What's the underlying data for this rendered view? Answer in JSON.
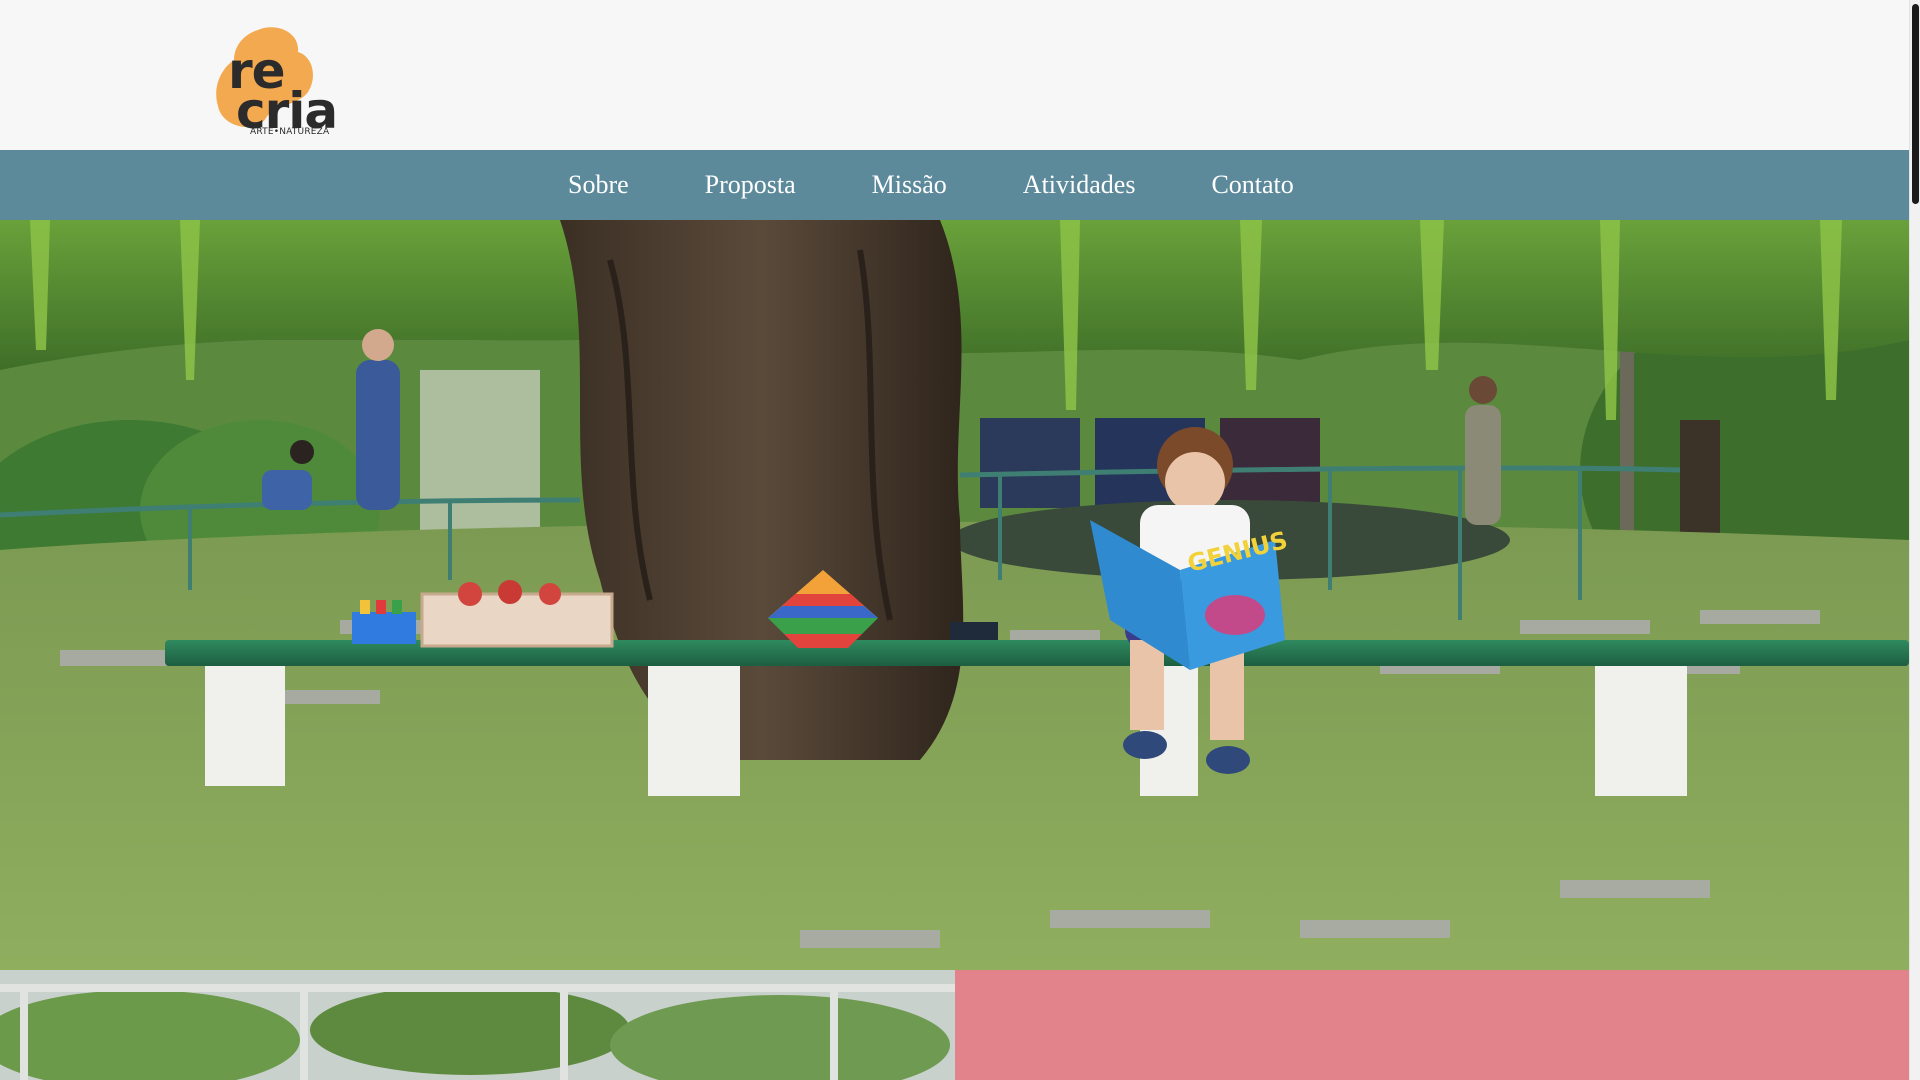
{
  "brand": {
    "word_top": "re",
    "word_bottom": "cria",
    "tagline": "ARTE•NATUREZA",
    "blob_color": "#f3a94f"
  },
  "nav": {
    "background": "#5d8a9b",
    "items": [
      {
        "label": "Sobre"
      },
      {
        "label": "Proposta"
      },
      {
        "label": "Missão"
      },
      {
        "label": "Atividades"
      },
      {
        "label": "Contato"
      }
    ]
  },
  "hero": {
    "book_cover_text": "GENIUS"
  },
  "lower_strip": {
    "right_panel_color": "#e2838b"
  }
}
